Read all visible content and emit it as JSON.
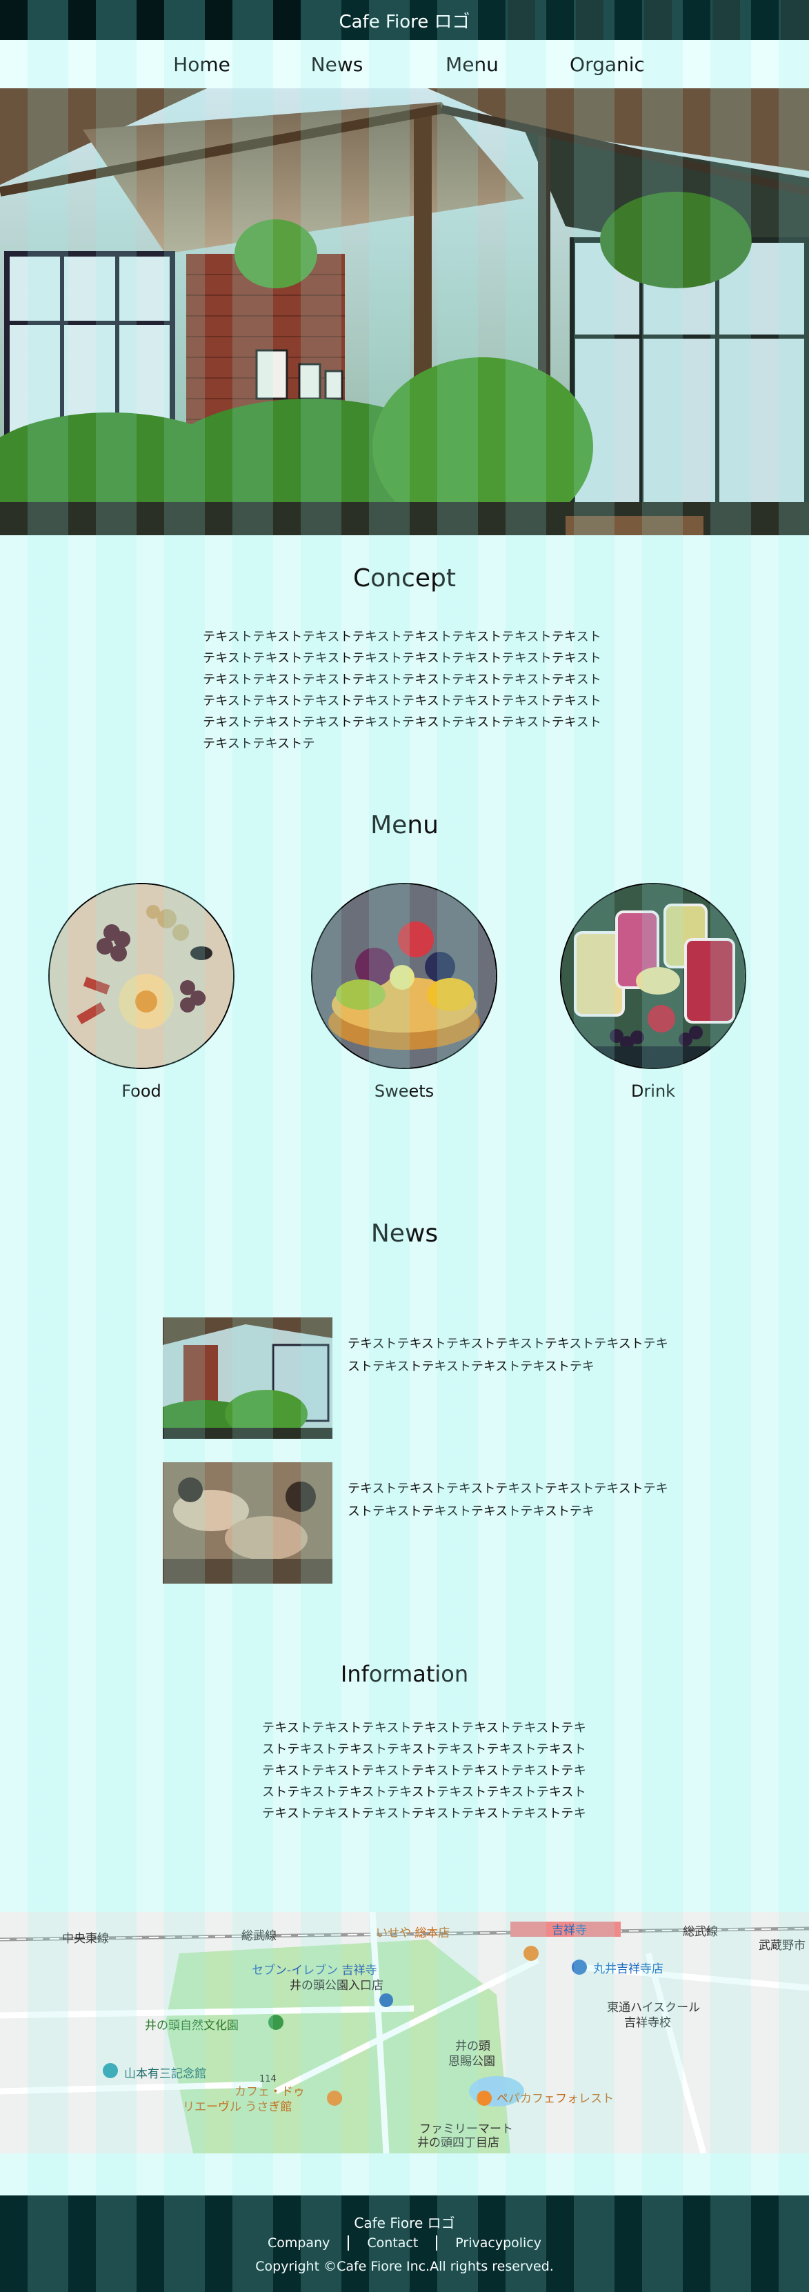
{
  "header": {
    "logo": "Cafe Fiore ロゴ"
  },
  "nav": {
    "items": [
      "Home",
      "News",
      "Menu",
      "Organic"
    ]
  },
  "concept": {
    "title": "Concept",
    "text": "テキストテキストテキストテキストテキストテキストテキストテキストテキストテキストテキストテキストテキストテキストテキストテキストテキストテキストテキストテキストテキストテキストテキストテキストテキストテキストテキストテキストテキストテキストテキストテキストテキストテキストテキストテキストテキストテキストテキストテキストテキストテキストテ"
  },
  "menu": {
    "title": "Menu",
    "items": [
      {
        "label": "Food"
      },
      {
        "label": "Sweets"
      },
      {
        "label": "Drink"
      }
    ]
  },
  "news": {
    "title": "News",
    "items": [
      {
        "text": "テキストテキストテキストテキストテキストテキストテキストテキストテキストテキストテキストテキ"
      },
      {
        "text": "テキストテキストテキストテキストテキストテキストテキストテキストテキストテキストテキストテキ"
      }
    ]
  },
  "information": {
    "title": "Information",
    "text": "テキストテキストテキストテキストテキストテキストテキストテキストテキストテキストテキストテキストテキストテキストテキストテキストテキストテキストテキストテキストテキストテキストテキストテキストテキストテキストテキストテキストテキストテキストテキストテキストテキ"
  },
  "map": {
    "labels": [
      "中央東線",
      "総武線",
      "いせや 総本店",
      "吉祥寺",
      "総武線",
      "武蔵野市",
      "井の頭自然文化園",
      "セブン-イレブン 吉祥寺",
      "井の頭公園入口店",
      "丸井吉祥寺店",
      "東通ハイスクール",
      "吉祥寺校",
      "山本有三記念館",
      "井の頭",
      "恩賜公園",
      "カフェ・ドゥ",
      "リエーヴル うさぎ館",
      "ペパカフェフォレスト",
      "ファミリーマート",
      "井の頭四丁目店",
      "114"
    ]
  },
  "footer": {
    "title": "Cafe Fiore ロゴ",
    "links": [
      "Company",
      "Contact",
      "Privacypolicy"
    ],
    "copyright": "Copyright ©Cafe Fiore Inc.All rights reserved."
  }
}
